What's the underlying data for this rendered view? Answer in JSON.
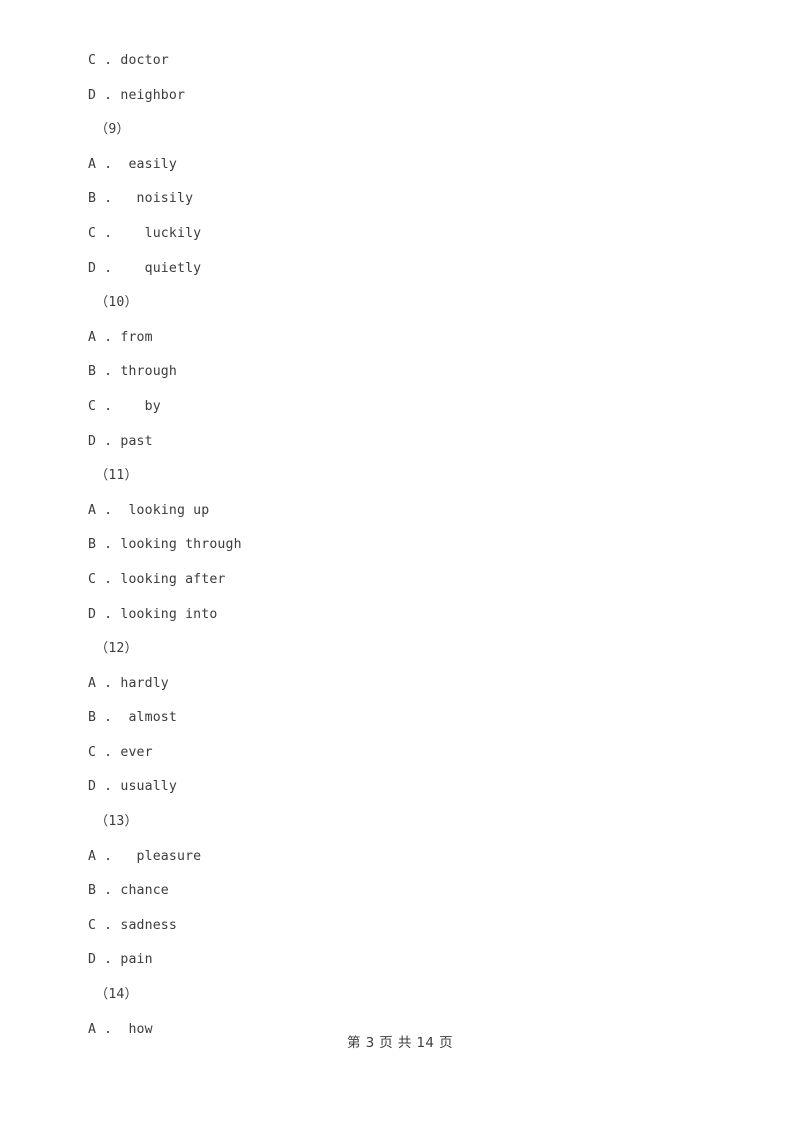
{
  "document": {
    "page_background": "#ffffff",
    "text_color": "#3c3c3c",
    "footer": "第 3 页 共 14 页"
  },
  "lines": [
    {
      "kind": "option",
      "text": "C . doctor"
    },
    {
      "kind": "option",
      "text": "D . neighbor"
    },
    {
      "kind": "question",
      "text": "（9）"
    },
    {
      "kind": "option",
      "text": "A .  easily"
    },
    {
      "kind": "option",
      "text": "B .   noisily"
    },
    {
      "kind": "option",
      "text": "C .    luckily"
    },
    {
      "kind": "option",
      "text": "D .    quietly"
    },
    {
      "kind": "question",
      "text": "（10）"
    },
    {
      "kind": "option",
      "text": "A . from"
    },
    {
      "kind": "option",
      "text": "B . through"
    },
    {
      "kind": "option",
      "text": "C .    by"
    },
    {
      "kind": "option",
      "text": "D . past"
    },
    {
      "kind": "question",
      "text": "（11）"
    },
    {
      "kind": "option",
      "text": "A .  looking up"
    },
    {
      "kind": "option",
      "text": "B . looking through"
    },
    {
      "kind": "option",
      "text": "C . looking after"
    },
    {
      "kind": "option",
      "text": "D . looking into"
    },
    {
      "kind": "question",
      "text": "（12）"
    },
    {
      "kind": "option",
      "text": "A . hardly"
    },
    {
      "kind": "option",
      "text": "B .  almost"
    },
    {
      "kind": "option",
      "text": "C . ever"
    },
    {
      "kind": "option",
      "text": "D . usually"
    },
    {
      "kind": "question",
      "text": "（13）"
    },
    {
      "kind": "option",
      "text": "A .   pleasure"
    },
    {
      "kind": "option",
      "text": "B . chance"
    },
    {
      "kind": "option",
      "text": "C . sadness"
    },
    {
      "kind": "option",
      "text": "D . pain"
    },
    {
      "kind": "question",
      "text": "（14）"
    },
    {
      "kind": "option",
      "text": "A .  how"
    }
  ]
}
